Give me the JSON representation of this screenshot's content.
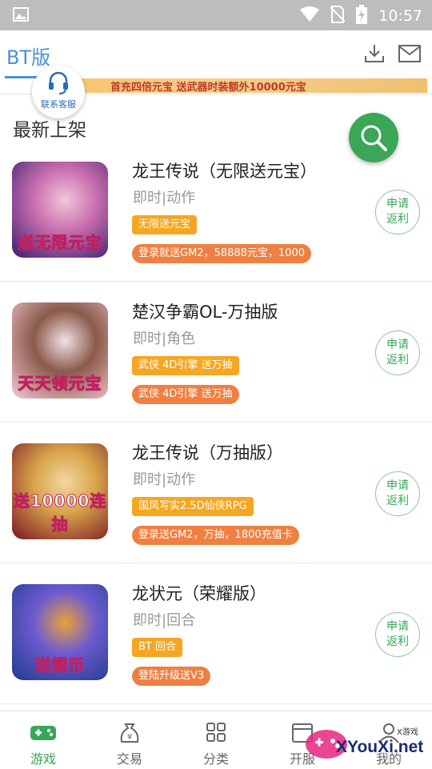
{
  "status_bar": {
    "time": "10:57"
  },
  "app_bar": {
    "title": "BT版"
  },
  "banner": {
    "text": "首充四倍元宝  送武器时装额外10000元宝"
  },
  "service": {
    "label": "联系客服"
  },
  "section": {
    "title": "最新上架"
  },
  "games": [
    {
      "name": "龙王传说（无限送元宝）",
      "genre": "即时|动作",
      "tag1": "无限送元宝",
      "tag2": "登录就送GM2，58888元宝，1000",
      "thumb_caption": "送无限元宝",
      "rebate_line1": "申请",
      "rebate_line2": "返利",
      "colors": [
        "#3b1d6e",
        "#c96fb0",
        "#f1c6d8"
      ]
    },
    {
      "name": "楚汉争霸OL-万抽版",
      "genre": "即时|角色",
      "tag1": "武侠 4D引擎 送万抽",
      "tag2": "武侠 4D引擎 送万抽",
      "thumb_caption": "天天领元宝",
      "rebate_line1": "申请",
      "rebate_line2": "返利",
      "colors": [
        "#f6c9d6",
        "#8a5a4a",
        "#f3e0e6"
      ]
    },
    {
      "name": "龙王传说（万抽版）",
      "genre": "即时|动作",
      "tag1": "国风写实2.5D仙侠RPG",
      "tag2": "登录送GM2，万抽，1800充值卡",
      "thumb_caption": "送10000连抽",
      "rebate_line1": "申请",
      "rebate_line2": "返利",
      "colors": [
        "#7a1424",
        "#d7a44a",
        "#f4d7a0"
      ]
    },
    {
      "name": "龙状元（荣耀版）",
      "genre": "即时|回合",
      "tag1": "BT 回合",
      "tag2": "登陆升级送V3",
      "thumb_caption": "送银币",
      "rebate_line1": "申请",
      "rebate_line2": "返利",
      "colors": [
        "#1f3b8c",
        "#6d5bd0",
        "#e9a23b"
      ]
    }
  ],
  "tabs": [
    {
      "label": "游戏",
      "icon": "gamepad-icon",
      "active": true
    },
    {
      "label": "交易",
      "icon": "money-bag-icon",
      "active": false
    },
    {
      "label": "分类",
      "icon": "grid-icon",
      "active": false
    },
    {
      "label": "开服",
      "icon": "calendar-icon",
      "active": false
    },
    {
      "label": "我的",
      "icon": "user-icon",
      "active": false
    }
  ],
  "watermark": {
    "text": "XYouXi.net",
    "small": "X游戏"
  },
  "colors": {
    "accent_blue": "#4a90d9",
    "accent_green": "#3aa657",
    "tag_yellow": "#f5a623",
    "tag_orange": "#ef8042"
  }
}
